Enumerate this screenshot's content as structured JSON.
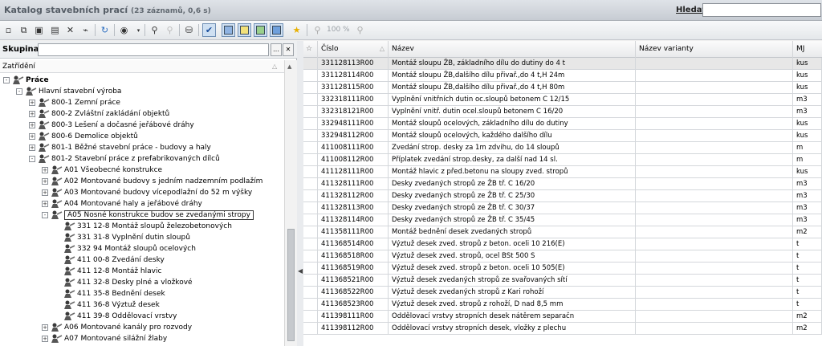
{
  "window": {
    "title": "Katalog stavebních prací",
    "count": "(23 záznamů, 0,6 s)",
    "search_label": "Hledat:",
    "search_value": ""
  },
  "toolbar": {
    "zoom": "100 %"
  },
  "left": {
    "group_label": "Skupina",
    "group_value": "",
    "zatrideni": "Zatřídění",
    "tree": [
      {
        "label": "Práce",
        "level": 0,
        "expander": "-",
        "bold": true
      },
      {
        "label": "Hlavní stavební výroba",
        "level": 1,
        "expander": "-"
      },
      {
        "label": "800-1 Zemní práce",
        "level": 2,
        "expander": "+"
      },
      {
        "label": "800-2 Zvláštní zakládání objektů",
        "level": 2,
        "expander": "+"
      },
      {
        "label": "800-3 Lešení a dočasné jeřábové dráhy",
        "level": 2,
        "expander": "+"
      },
      {
        "label": "800-6 Demolice objektů",
        "level": 2,
        "expander": "+"
      },
      {
        "label": "801-1 Běžné stavební práce - budovy a haly",
        "level": 2,
        "expander": "+"
      },
      {
        "label": "801-2 Stavební práce z prefabrikovaných dílců",
        "level": 2,
        "expander": "-"
      },
      {
        "label": "A01 Všeobecné konstrukce",
        "level": 3,
        "expander": "+"
      },
      {
        "label": "A02 Montované budovy s jedním nadzemním podlažím",
        "level": 3,
        "expander": "+"
      },
      {
        "label": "A03 Montované budovy vícepodlažní do 52 m výšky",
        "level": 3,
        "expander": "+"
      },
      {
        "label": "A04 Montované haly a jeřábové dráhy",
        "level": 3,
        "expander": "+"
      },
      {
        "label": "A05 Nosné konstrukce budov se zvedanými stropy",
        "level": 3,
        "expander": "-",
        "selected": true
      },
      {
        "label": "331 12-8 Montáž sloupů železobetonových",
        "level": 4,
        "expander": ""
      },
      {
        "label": "331 31-8 Vyplnění dutin sloupů",
        "level": 4,
        "expander": ""
      },
      {
        "label": "332 94 Montáž sloupů ocelových",
        "level": 4,
        "expander": ""
      },
      {
        "label": "411 00-8 Zvedání desky",
        "level": 4,
        "expander": ""
      },
      {
        "label": "411 12-8 Montáž hlavic",
        "level": 4,
        "expander": ""
      },
      {
        "label": "411 32-8 Desky plné a vložkové",
        "level": 4,
        "expander": ""
      },
      {
        "label": "411 35-8 Bednění desek",
        "level": 4,
        "expander": ""
      },
      {
        "label": "411 36-8 Výztuž desek",
        "level": 4,
        "expander": ""
      },
      {
        "label": "411 39-8 Oddělovací vrstvy",
        "level": 4,
        "expander": ""
      },
      {
        "label": "A06 Montované kanály pro rozvody",
        "level": 3,
        "expander": "+"
      },
      {
        "label": "A07 Montované silážní žlaby",
        "level": 3,
        "expander": "+"
      }
    ]
  },
  "table": {
    "columns": [
      "Číslo",
      "Název",
      "Název varianty",
      "MJ"
    ],
    "rows": [
      {
        "cislo": "331128113R00",
        "nazev": "Montáž sloupu ŽB, základního dílu do dutiny do 4 t",
        "varianta": "",
        "mj": "kus"
      },
      {
        "cislo": "331128114R00",
        "nazev": "Montáž sloupu ŽB,dalšího dílu přivař.,do 4 t,H 24m",
        "varianta": "",
        "mj": "kus"
      },
      {
        "cislo": "331128115R00",
        "nazev": "Montáž sloupu ŽB,dalšího dílu přivař.,do 4 t,H 80m",
        "varianta": "",
        "mj": "kus"
      },
      {
        "cislo": "332318111R00",
        "nazev": "Vyplnění vnitřních dutin oc.sloupů betonem C 12/15",
        "varianta": "",
        "mj": "m3"
      },
      {
        "cislo": "332318121R00",
        "nazev": "Vyplnění vnitř. dutin ocel.sloupů betonem C 16/20",
        "varianta": "",
        "mj": "m3"
      },
      {
        "cislo": "332948111R00",
        "nazev": "Montáž sloupů ocelových, základního dílu do dutiny",
        "varianta": "",
        "mj": "kus"
      },
      {
        "cislo": "332948112R00",
        "nazev": "Montáž sloupů ocelových, každého dalšího dílu",
        "varianta": "",
        "mj": "kus"
      },
      {
        "cislo": "411008111R00",
        "nazev": "Zvedání strop. desky za 1m zdvihu, do 14 sloupů",
        "varianta": "",
        "mj": "m"
      },
      {
        "cislo": "411008112R00",
        "nazev": "Příplatek zvedání strop.desky, za další nad 14 sl.",
        "varianta": "",
        "mj": "m"
      },
      {
        "cislo": "411128111R00",
        "nazev": "Montáž hlavic z před.betonu na sloupy zved. stropů",
        "varianta": "",
        "mj": "kus"
      },
      {
        "cislo": "411328111R00",
        "nazev": "Desky zvedaných stropů ze ŽB tř. C 16/20",
        "varianta": "",
        "mj": "m3"
      },
      {
        "cislo": "411328112R00",
        "nazev": "Desky zvedaných stropů ze ŽB tř. C 25/30",
        "varianta": "",
        "mj": "m3"
      },
      {
        "cislo": "411328113R00",
        "nazev": "Desky zvedaných stropů ze ŽB tř. C 30/37",
        "varianta": "",
        "mj": "m3"
      },
      {
        "cislo": "411328114R00",
        "nazev": "Desky zvedaných stropů ze ŽB tř. C 35/45",
        "varianta": "",
        "mj": "m3"
      },
      {
        "cislo": "411358111R00",
        "nazev": "Montáž bednění desek zvedaných stropů",
        "varianta": "",
        "mj": "m2"
      },
      {
        "cislo": "411368514R00",
        "nazev": "Výztuž desek zved. stropů z beton. oceli 10 216(E)",
        "varianta": "",
        "mj": "t"
      },
      {
        "cislo": "411368518R00",
        "nazev": "Výztuž desek zved. stropů, ocel BSt 500 S",
        "varianta": "",
        "mj": "t"
      },
      {
        "cislo": "411368519R00",
        "nazev": "Výztuž desek zved. stropů z beton. oceli 10 505(E)",
        "varianta": "",
        "mj": "t"
      },
      {
        "cislo": "411368521R00",
        "nazev": "Výztuž desek zvedaných stropů ze svařovaných sítí",
        "varianta": "",
        "mj": "t"
      },
      {
        "cislo": "411368522R00",
        "nazev": "Výztuž desek zvedaných stropů z Kari rohoží",
        "varianta": "",
        "mj": "t"
      },
      {
        "cislo": "411368523R00",
        "nazev": "Výztuž desek zved. stropů z rohoží, D nad 8,5 mm",
        "varianta": "",
        "mj": "t"
      },
      {
        "cislo": "411398111R00",
        "nazev": "Oddělovací vrstvy stropních desek nátěrem separačn",
        "varianta": "",
        "mj": "m2"
      },
      {
        "cislo": "411398112R00",
        "nazev": "Oddělovací vrstvy stropních desek, vložky z plechu",
        "varianta": "",
        "mj": "m2"
      }
    ]
  }
}
